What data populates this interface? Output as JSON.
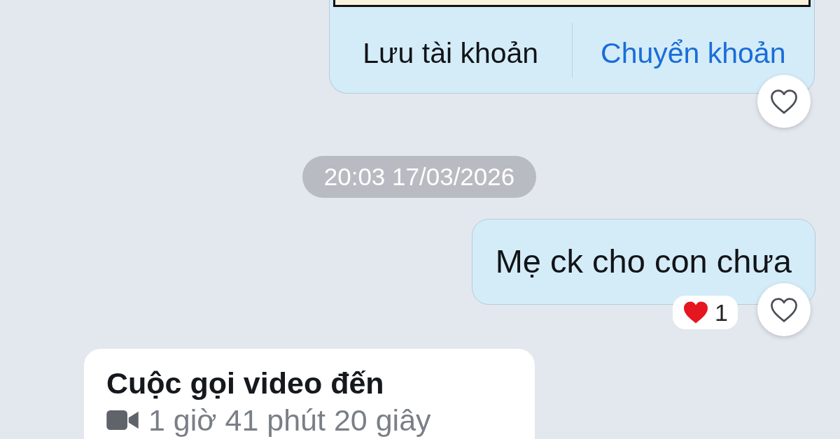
{
  "messages": [
    {
      "kind": "transfer_card",
      "outgoing": true,
      "actions": [
        {
          "label": "Lưu tài khoản",
          "kind": "default"
        },
        {
          "label": "Chuyển khoản",
          "kind": "primary"
        }
      ]
    },
    {
      "kind": "timestamp",
      "text": "20:03 17/03/2026"
    },
    {
      "kind": "text",
      "outgoing": true,
      "text": "Mẹ ck cho con chưa",
      "reaction": {
        "count": "1"
      }
    },
    {
      "kind": "call",
      "outgoing": false,
      "title": "Cuộc gọi video đến",
      "duration": "1 giờ 41 phút 20 giây"
    }
  ]
}
